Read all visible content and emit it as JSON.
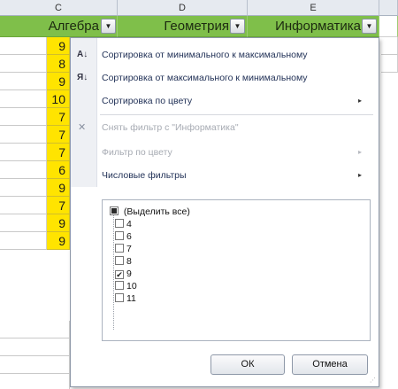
{
  "columns": {
    "letters": [
      "C",
      "D",
      "E"
    ],
    "headers": [
      "Алгебра",
      "Геометрия",
      "Информатика"
    ]
  },
  "algebra_values": [
    "9",
    "8",
    "9",
    "10",
    "7",
    "7",
    "7",
    "6",
    "9",
    "7",
    "9",
    "9"
  ],
  "colors": {
    "header_green": "#7fbf4a",
    "cell_yellow": "#ffe400"
  },
  "menu": {
    "sort_asc": "Сортировка от минимального к максимальному",
    "sort_desc": "Сортировка от максимального к минимальному",
    "sort_by_color": "Сортировка по цвету",
    "clear_filter": "Снять фильтр с \"Информатика\"",
    "filter_by_color": "Фильтр по цвету",
    "number_filters": "Числовые фильтры"
  },
  "filter_list": {
    "select_all": "(Выделить все)",
    "items": [
      {
        "label": "4",
        "checked": false
      },
      {
        "label": "6",
        "checked": false
      },
      {
        "label": "7",
        "checked": false
      },
      {
        "label": "8",
        "checked": false
      },
      {
        "label": "9",
        "checked": true
      },
      {
        "label": "10",
        "checked": false
      },
      {
        "label": "11",
        "checked": false
      }
    ]
  },
  "buttons": {
    "ok": "ОК",
    "cancel": "Отмена"
  },
  "icons": {
    "sort_asc": "sort-az-icon",
    "sort_desc": "sort-za-icon",
    "clear_filter": "clear-filter-icon"
  }
}
